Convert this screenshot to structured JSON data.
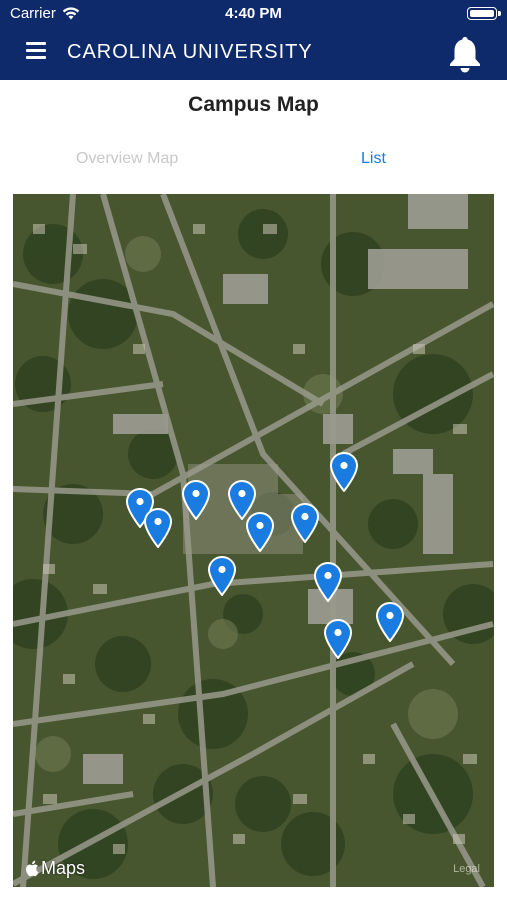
{
  "status_bar": {
    "carrier": "Carrier",
    "time": "4:40 PM"
  },
  "header": {
    "title": "CAROLINA UNIVERSITY"
  },
  "page": {
    "title": "Campus Map"
  },
  "tabs": [
    {
      "label": "Overview Map"
    },
    {
      "label": "List"
    }
  ],
  "map": {
    "attribution": "Maps",
    "legal": "Legal",
    "pin_count": 12
  },
  "colors": {
    "brand": "#0e2a6b",
    "accent": "#1a7be0",
    "pin": "#1a7be0"
  },
  "icons": [
    "wifi-icon",
    "battery-icon",
    "menu-icon",
    "bell-icon",
    "map-pin-icon",
    "apple-logo-icon"
  ]
}
